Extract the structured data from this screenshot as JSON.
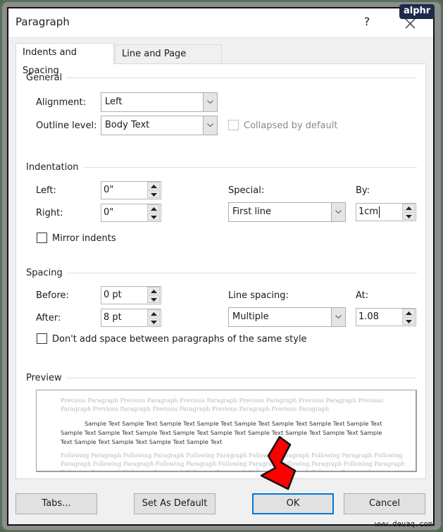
{
  "window": {
    "title": "Paragraph",
    "help_label": "?",
    "close_icon": "close-icon"
  },
  "watermarks": {
    "top_right": "alphr",
    "bottom_right": "www.deuaq.com"
  },
  "tabs": [
    {
      "label": "Indents and Spacing",
      "active": true
    },
    {
      "label": "Line and Page Breaks",
      "active": false
    }
  ],
  "general": {
    "heading": "General",
    "alignment_label": "Alignment:",
    "alignment_value": "Left",
    "outline_label": "Outline level:",
    "outline_value": "Body Text",
    "collapsed_label": "Collapsed by default",
    "collapsed_checked": false,
    "collapsed_enabled": false
  },
  "indentation": {
    "heading": "Indentation",
    "left_label": "Left:",
    "left_value": "0\"",
    "right_label": "Right:",
    "right_value": "0\"",
    "special_label": "Special:",
    "special_value": "First line",
    "by_label": "By:",
    "by_value": "1cm",
    "mirror_label": "Mirror indents",
    "mirror_checked": false
  },
  "spacing": {
    "heading": "Spacing",
    "before_label": "Before:",
    "before_value": "0 pt",
    "after_label": "After:",
    "after_value": "8 pt",
    "line_spacing_label": "Line spacing:",
    "line_spacing_value": "Multiple",
    "at_label": "At:",
    "at_value": "1.08",
    "dont_add_label": "Don't add space between paragraphs of the same style",
    "dont_add_checked": false
  },
  "preview": {
    "heading": "Preview",
    "previous_lines": [
      "Previous Paragraph Previous Paragraph Previous Paragraph Previous Paragraph Previous Paragraph Previous",
      "Paragraph Previous Paragraph Previous Paragraph Previous Paragraph Previous Paragraph"
    ],
    "sample_lines": [
      "Sample Text Sample Text Sample Text Sample Text Sample Text Sample Text Sample Text Sample Text",
      "Sample Text Sample Text Sample Text Sample Text Sample Text Sample Text Sample Text Sample Text Sample",
      "Text Sample Text Sample Text Sample Text Sample Text"
    ],
    "following_lines": [
      "Following Paragraph Following Paragraph Following Paragraph Following Paragraph Following Paragraph Following",
      "Paragraph Following Paragraph Following Paragraph Following Paragraph Following Paragraph Following Paragraph",
      "Following Paragraph Following Paragraph Following Paragraph Following Paragraph Following Paragraph"
    ]
  },
  "buttons": {
    "tabs": "Tabs...",
    "set_default": "Set As Default",
    "ok": "OK",
    "cancel": "Cancel"
  },
  "annotation": {
    "arrow_color": "#ff0000",
    "points_to": "ok-button"
  },
  "colors": {
    "accent": "#0078d7",
    "dialog_bg": "#f0f0f0",
    "panel_bg": "#ffffff"
  }
}
